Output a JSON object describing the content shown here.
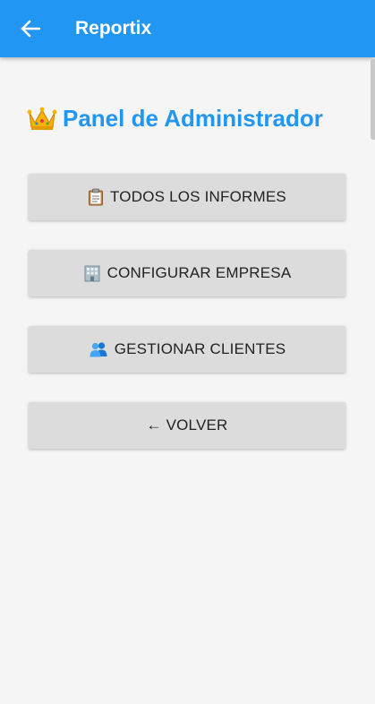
{
  "app_bar": {
    "title": "Reportix",
    "back_icon": "arrow-left-icon",
    "color": "#2196f3"
  },
  "panel": {
    "title": "Panel de Administrador",
    "title_icon": "crown-icon",
    "title_color": "#2196f3"
  },
  "buttons": [
    {
      "icon": "clipboard-icon",
      "label": "TODOS LOS INFORMES"
    },
    {
      "icon": "office-building-icon",
      "label": "CONFIGURAR EMPRESA"
    },
    {
      "icon": "people-icon",
      "label": "GESTIONAR CLIENTES"
    },
    {
      "icon": "left-arrow-icon",
      "label": "← VOLVER"
    }
  ]
}
